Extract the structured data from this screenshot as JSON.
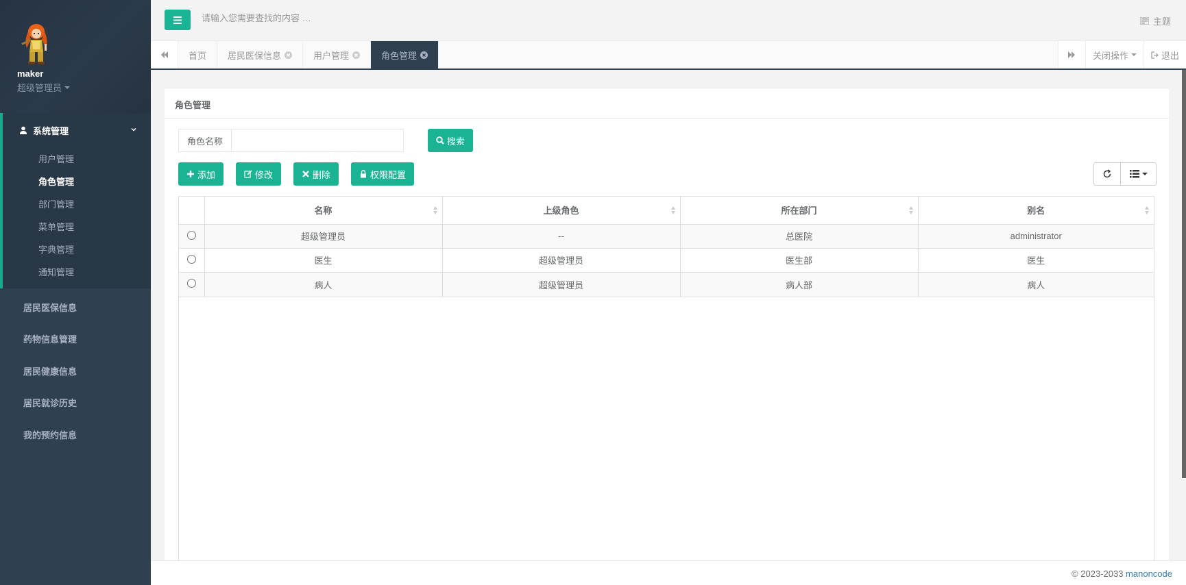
{
  "sidebar": {
    "username": "maker",
    "role": "超级管理员",
    "group": {
      "label": "系统管理",
      "items": [
        {
          "label": "用户管理",
          "active": false
        },
        {
          "label": "角色管理",
          "active": true
        },
        {
          "label": "部门管理",
          "active": false
        },
        {
          "label": "菜单管理",
          "active": false
        },
        {
          "label": "字典管理",
          "active": false
        },
        {
          "label": "通知管理",
          "active": false
        }
      ]
    },
    "items": [
      "居民医保信息",
      "药物信息管理",
      "居民健康信息",
      "居民就诊历史",
      "我的预约信息"
    ]
  },
  "topbar": {
    "search_placeholder": "请输入您需要查找的内容 …",
    "theme_label": "主题"
  },
  "tabs": {
    "items": [
      {
        "label": "首页",
        "closable": false
      },
      {
        "label": "居民医保信息",
        "closable": true
      },
      {
        "label": "用户管理",
        "closable": true
      },
      {
        "label": "角色管理",
        "closable": true,
        "active": true
      }
    ],
    "close_ops": "关闭操作",
    "logout": "退出"
  },
  "panel": {
    "title": "角色管理",
    "filter_label": "角色名称",
    "filter_value": "",
    "search_btn": "搜索",
    "buttons": {
      "add": "添加",
      "edit": "修改",
      "delete": "删除",
      "perm": "权限配置"
    }
  },
  "table": {
    "headers": [
      "名称",
      "上级角色",
      "所在部门",
      "别名"
    ],
    "rows": [
      [
        "超级管理员",
        "--",
        "总医院",
        "administrator"
      ],
      [
        "医生",
        "超级管理员",
        "医生部",
        "医生"
      ],
      [
        "病人",
        "超级管理员",
        "病人部",
        "病人"
      ]
    ]
  },
  "footer": {
    "copyright": "© 2023-2033 ",
    "link": "manoncode"
  },
  "colors": {
    "accent": "#1ab394",
    "sidebar": "#2f4050"
  }
}
